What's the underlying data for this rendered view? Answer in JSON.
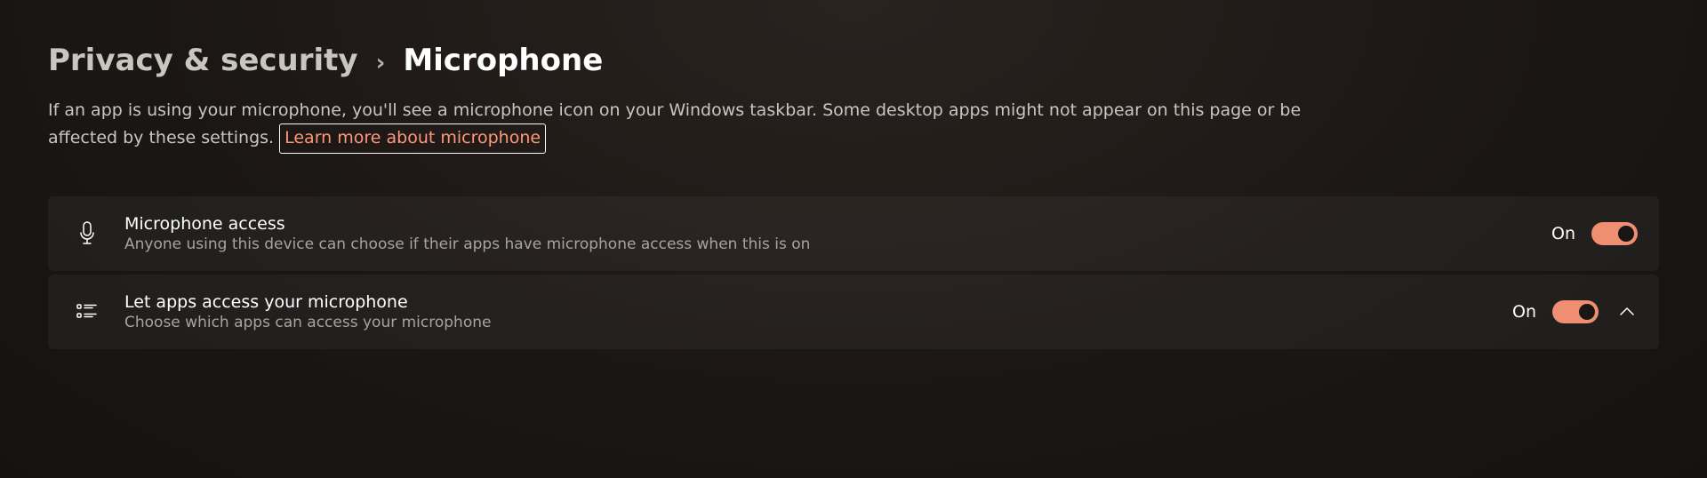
{
  "breadcrumb": {
    "parent": "Privacy & security",
    "separator": "›",
    "current": "Microphone"
  },
  "description": {
    "text": "If an app is using your microphone, you'll see a microphone icon on your Windows taskbar. Some desktop apps might not appear on this page or be affected by these settings. ",
    "link_label": "Learn more about microphone"
  },
  "settings": [
    {
      "icon": "microphone-icon",
      "title": "Microphone access",
      "subtitle": "Anyone using this device can choose if their apps have microphone access when this is on",
      "state_label": "On",
      "toggle_on": true,
      "expandable": false
    },
    {
      "icon": "list-icon",
      "title": "Let apps access your microphone",
      "subtitle": "Choose which apps can access your microphone",
      "state_label": "On",
      "toggle_on": true,
      "expandable": true
    }
  ],
  "colors": {
    "accent": "#f08e72",
    "link": "#ff977a"
  }
}
